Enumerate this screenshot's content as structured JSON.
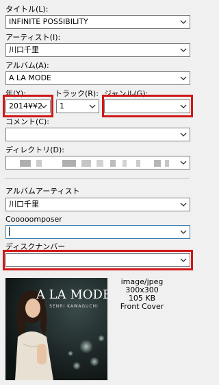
{
  "fields": {
    "title": {
      "label": "タイトル(L):",
      "value": "INFINITE POSSIBILITY"
    },
    "artist": {
      "label": "アーティスト(I):",
      "value": "川口千里"
    },
    "album": {
      "label": "アルバム(A):",
      "value": "A LA MODE"
    },
    "year": {
      "label": "年(Y):",
      "value": "2014¥¥2"
    },
    "track": {
      "label": "トラック(R):",
      "value": "1"
    },
    "genre": {
      "label": "ジャンル(G):",
      "value": ""
    },
    "comment": {
      "label": "コメント(C):",
      "value": ""
    },
    "directory": {
      "label": "ディレクトリ(D):",
      "value": ""
    },
    "album_artist": {
      "label": "アルバムアーティスト",
      "value": "川口千里"
    },
    "composer": {
      "label": "Cooooomposer",
      "value": ""
    },
    "disc_number": {
      "label": "ディスクナンバー",
      "value": ""
    }
  },
  "album_art": {
    "mime": "image/jpeg",
    "dimensions": "300x300",
    "size": "105 KB",
    "type": "Front Cover",
    "cover_title": "A LA MODE",
    "cover_subtitle": "SENRI KAWAGUCHI"
  },
  "colors": {
    "highlight": "#d01818",
    "background": "#f0f0f0",
    "field_border": "#7a7a7a",
    "focus_border": "#3c7fb1"
  }
}
